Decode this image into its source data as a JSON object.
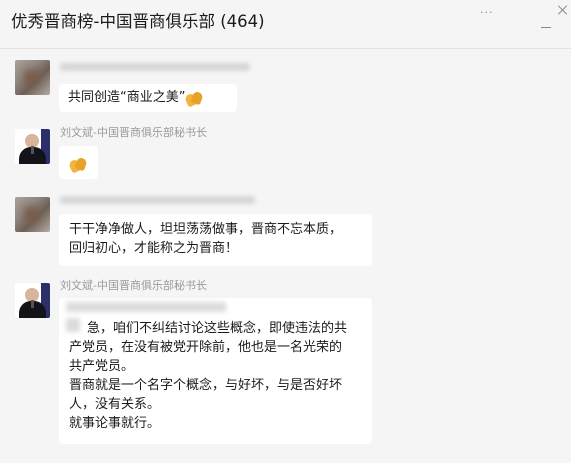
{
  "header": {
    "title": "优秀晋商榜-中国晋商俱乐部 (464)",
    "more_label": "···"
  },
  "messages": [
    {
      "sender": "",
      "text": "共同创造“商业之美”",
      "emoji": "folded-hands"
    },
    {
      "sender": "刘文斌-中国晋商俱乐部秘书长",
      "text": "",
      "emoji": "folded-hands"
    },
    {
      "sender": "",
      "lines": [
        "干干净净做人，坦坦荡荡做事，晋商不忘本质，",
        "回归初心，才能称之为晋商！"
      ]
    },
    {
      "sender": "刘文斌-中国晋商俱乐部秘书长",
      "lines": [
        "急，咱们不纠结讨论这些概念，即使违法的共",
        "产党员，在没有被党开除前，他也是一名光荣的",
        "共产党员。",
        "晋商就是一个名字个概念，与好坏，与是否好坏",
        "人，没有关系。",
        "就事论事就行。"
      ]
    }
  ]
}
